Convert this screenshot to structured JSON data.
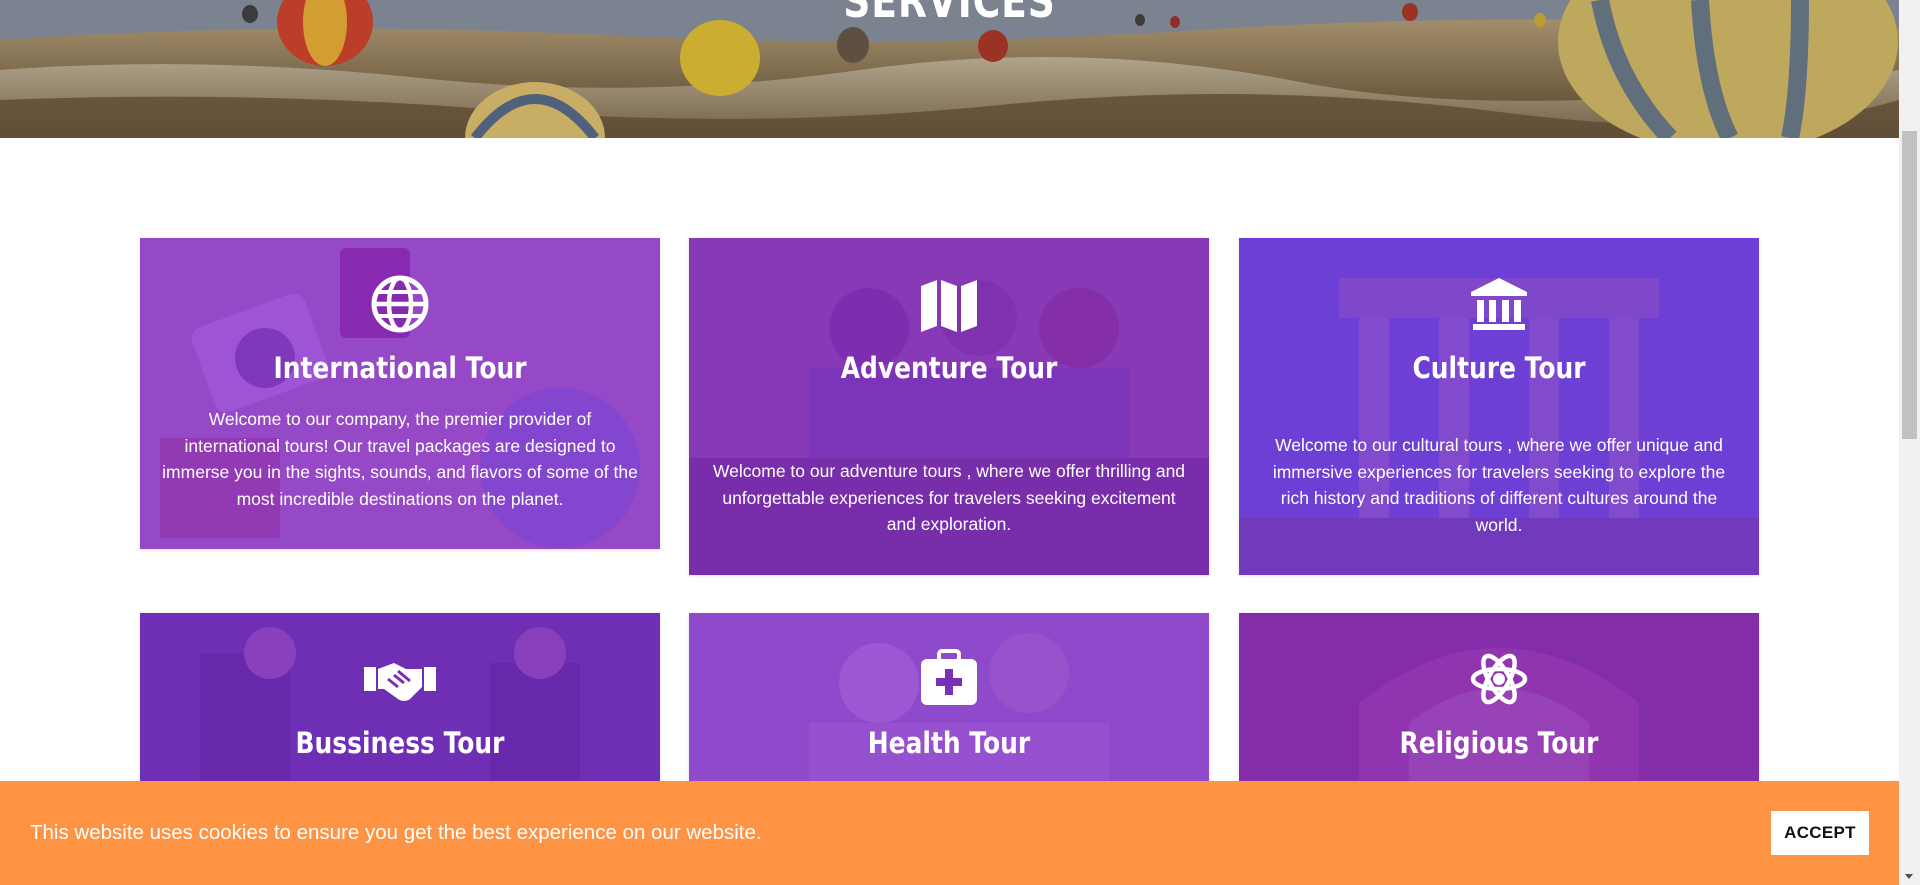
{
  "hero": {
    "title": "SERVICES"
  },
  "cards": [
    {
      "title": "International Tour",
      "icon": "globe-icon",
      "text": "Welcome to our company, the premier provider of international tours! Our travel packages are designed to immerse you in the sights, sounds, and flavors of some of the most incredible destinations on the planet."
    },
    {
      "title": "Adventure Tour",
      "icon": "map-icon",
      "text": "Welcome to our adventure tours , where we offer thrilling and unforgettable experiences for travelers seeking excitement and exploration."
    },
    {
      "title": "Culture Tour",
      "icon": "landmark-icon",
      "text": "Welcome to our cultural tours , where we offer unique and immersive experiences for travelers seeking to explore the rich history and traditions of different cultures around the world."
    },
    {
      "title": "Bussiness Tour",
      "icon": "handshake-icon",
      "text": ""
    },
    {
      "title": "Health Tour",
      "icon": "medkit-icon",
      "text": ""
    },
    {
      "title": "Religious Tour",
      "icon": "atom-icon",
      "text": ""
    }
  ],
  "cookie_banner": {
    "message": "This website uses cookies to ensure you get the best experience on our website.",
    "accept_label": "ACCEPT"
  },
  "colors": {
    "card_tint": "#8a2be2",
    "cookie_bg": "#fe9344",
    "accent_white": "#ffffff"
  }
}
